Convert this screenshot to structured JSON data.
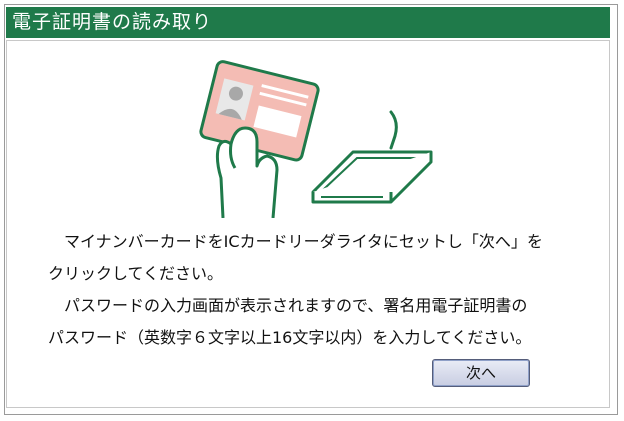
{
  "dialog": {
    "title": "電子証明書の読み取り"
  },
  "instructions": {
    "line1": "　マイナンバーカードをICカードリーダライタにセットし「次へ」を",
    "line2": "クリックしてください。",
    "line3": "　パスワードの入力画面が表示されますので、署名用電子証明書の",
    "line4": "パスワード（英数字６文字以上16文字以内）を入力してください。"
  },
  "buttons": {
    "next_label": "次へ"
  },
  "colors": {
    "title_bar": "#1f7a4a",
    "illustration_stroke": "#1f7a4a",
    "card_fill": "#f4bcb4"
  },
  "icons": {
    "illustration": "hand-holding-card-over-card-reader-illustration"
  }
}
